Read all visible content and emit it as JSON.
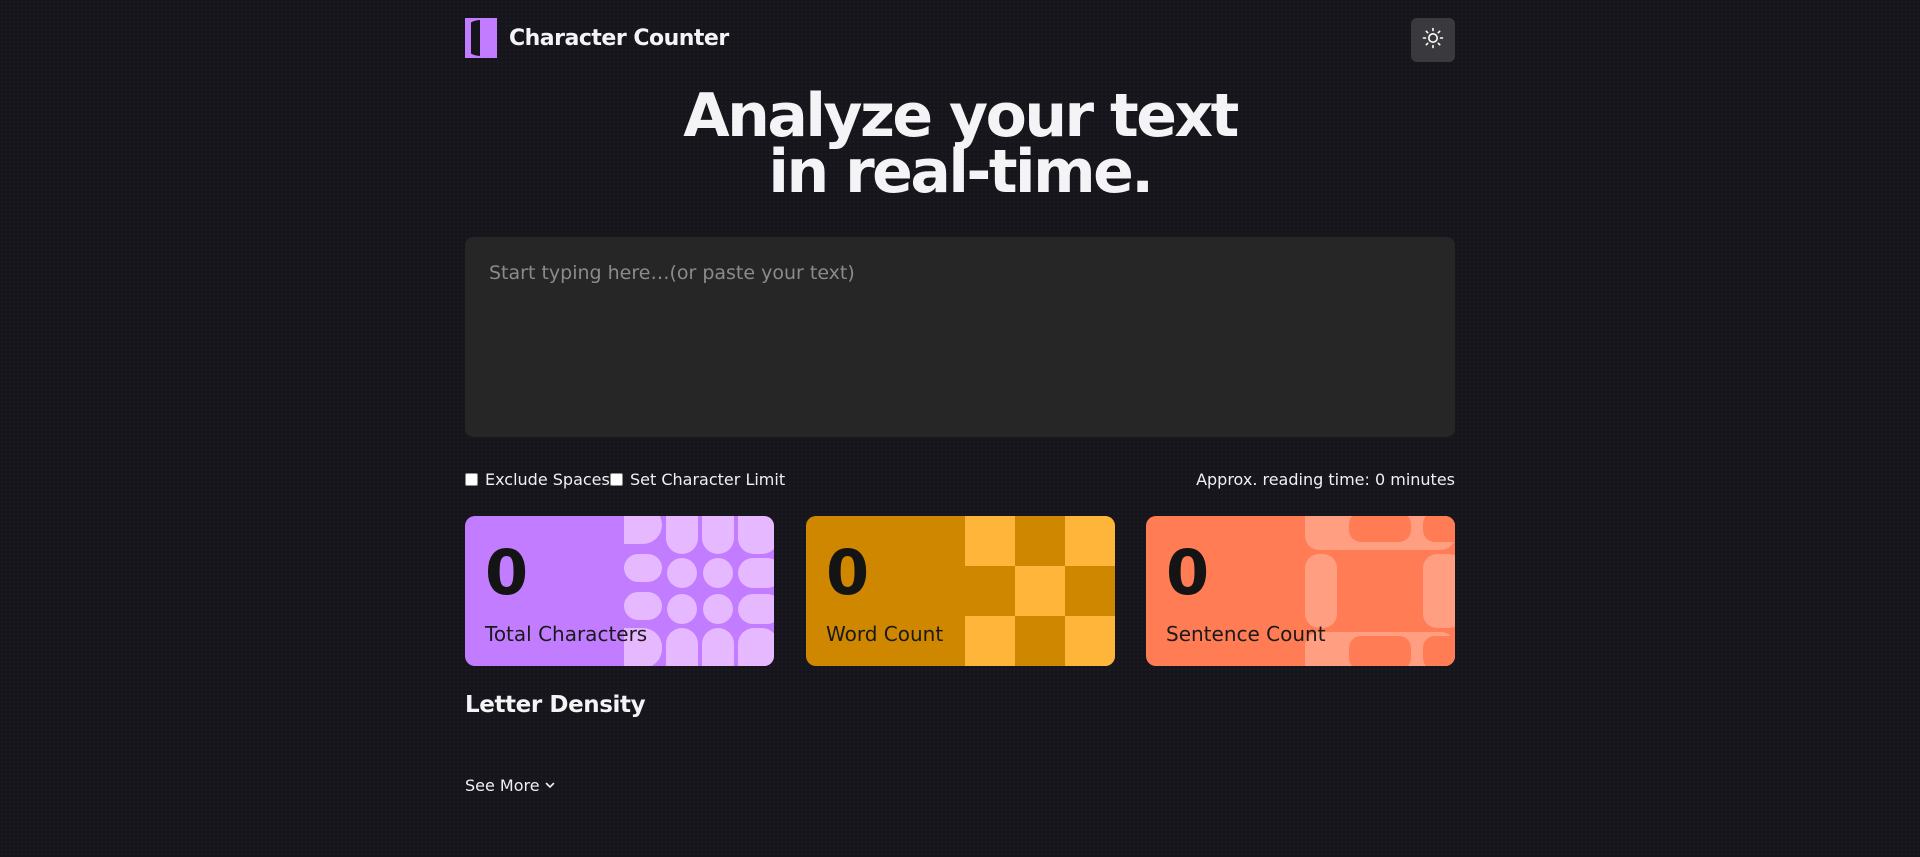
{
  "app": {
    "name": "Character Counter",
    "logo_icon": "half-circle-logo-icon",
    "theme_toggle_icon": "sun-icon"
  },
  "hero": {
    "line1": "Analyze your text",
    "line2": "in real-time."
  },
  "editor": {
    "placeholder": "Start typing here…(or paste your text)",
    "value": ""
  },
  "options": {
    "exclude_spaces_label": "Exclude Spaces",
    "exclude_spaces_checked": false,
    "char_limit_label": "Set Character Limit",
    "char_limit_checked": false,
    "reading_time": "Approx. reading time: 0 minutes"
  },
  "stats": [
    {
      "value": "0",
      "label": "Total Characters",
      "color": "#c27cff"
    },
    {
      "value": "0",
      "label": "Word Count",
      "color": "#d08700"
    },
    {
      "value": "0",
      "label": "Sentence Count",
      "color": "#ff7c55"
    }
  ],
  "density": {
    "title": "Letter Density",
    "see_more_label": "See More",
    "see_more_icon": "chevron-down-icon"
  }
}
